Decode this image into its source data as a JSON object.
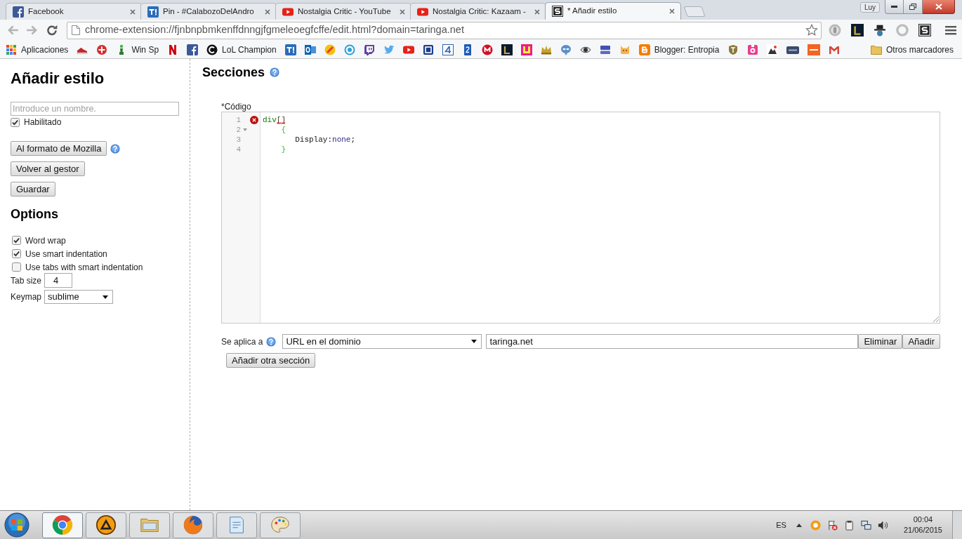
{
  "window": {
    "profile": "Luy"
  },
  "tabs": [
    {
      "title": "Facebook",
      "selected": false
    },
    {
      "title": "Pin - #CalabozoDelAndro",
      "selected": false
    },
    {
      "title": "Nostalgia Critic - YouTube",
      "selected": false
    },
    {
      "title": "Nostalgia Critic: Kazaam -",
      "selected": false
    },
    {
      "title": "* Añadir estilo",
      "selected": true
    }
  ],
  "toolbar": {
    "back": {
      "disabled": true
    },
    "forward": {
      "disabled": true
    },
    "address": "chrome-extension://fjnbnpbmkenffdnngjfgmeleoegfcffe/edit.html?domain=taringa.net"
  },
  "bookmarks": [
    {
      "label": "Aplicaciones"
    },
    {
      "label": "Win Sp"
    },
    {
      "label": "LoL Champion"
    },
    {
      "label": "Blogger: Entropia"
    }
  ],
  "other_bookmarks": {
    "label": "Otros marcadores"
  },
  "sidebar": {
    "title": "Añadir estilo",
    "name_field": {
      "placeholder": "Introduce un nombre."
    },
    "enabled": {
      "label": "Habilitado",
      "checked": true
    },
    "buttons": [
      {
        "label": "Al formato de Mozilla",
        "help": true
      },
      {
        "label": "Volver al gestor",
        "help": false
      },
      {
        "label": "Guardar",
        "help": false
      }
    ],
    "options_title": "Options",
    "options": [
      {
        "label": "Word wrap",
        "checked": true
      },
      {
        "label": "Use smart indentation",
        "checked": true
      },
      {
        "label": "Use tabs with smart indentation",
        "checked": false
      }
    ],
    "tab_size": {
      "label": "Tab size",
      "value": "4"
    },
    "keymap": {
      "label": "Keymap",
      "value": "sublime"
    }
  },
  "sections": {
    "title": "Secciones",
    "code_label": "*Código",
    "lines": [
      {
        "number": "1",
        "error": true,
        "foldable": false,
        "tokens": [
          {
            "text": "div",
            "kind": "tag",
            "error": false
          },
          {
            "text": "[]",
            "kind": "bracket",
            "error": true
          }
        ]
      },
      {
        "number": "2",
        "error": false,
        "foldable": true,
        "tokens": [
          {
            "text": "    {",
            "kind": "brace",
            "error": false
          }
        ]
      },
      {
        "number": "3",
        "error": false,
        "foldable": false,
        "tokens": [
          {
            "text": "       Display",
            "kind": "property",
            "error": false
          },
          {
            "text": ":",
            "kind": "punct",
            "error": false
          },
          {
            "text": "none",
            "kind": "atom",
            "error": false
          },
          {
            "text": ";",
            "kind": "punct",
            "error": false
          }
        ]
      },
      {
        "number": "4",
        "error": false,
        "foldable": false,
        "tokens": [
          {
            "text": "    }",
            "kind": "brace",
            "error": false
          }
        ]
      }
    ],
    "applies_to": {
      "label": "Se aplica a",
      "type": "URL en el dominio",
      "value": "taringa.net"
    },
    "buttons": [
      {
        "label": "Eliminar"
      },
      {
        "label": "Añadir"
      }
    ],
    "add_section": {
      "label": "Añadir otra sección"
    }
  },
  "taskbar": {
    "apps": [
      {
        "selected": true
      },
      {
        "selected": false
      },
      {
        "selected": false
      },
      {
        "selected": false
      },
      {
        "selected": false
      },
      {
        "selected": false
      }
    ],
    "language": "ES",
    "time": "00:04",
    "date": "21/06/2015"
  }
}
